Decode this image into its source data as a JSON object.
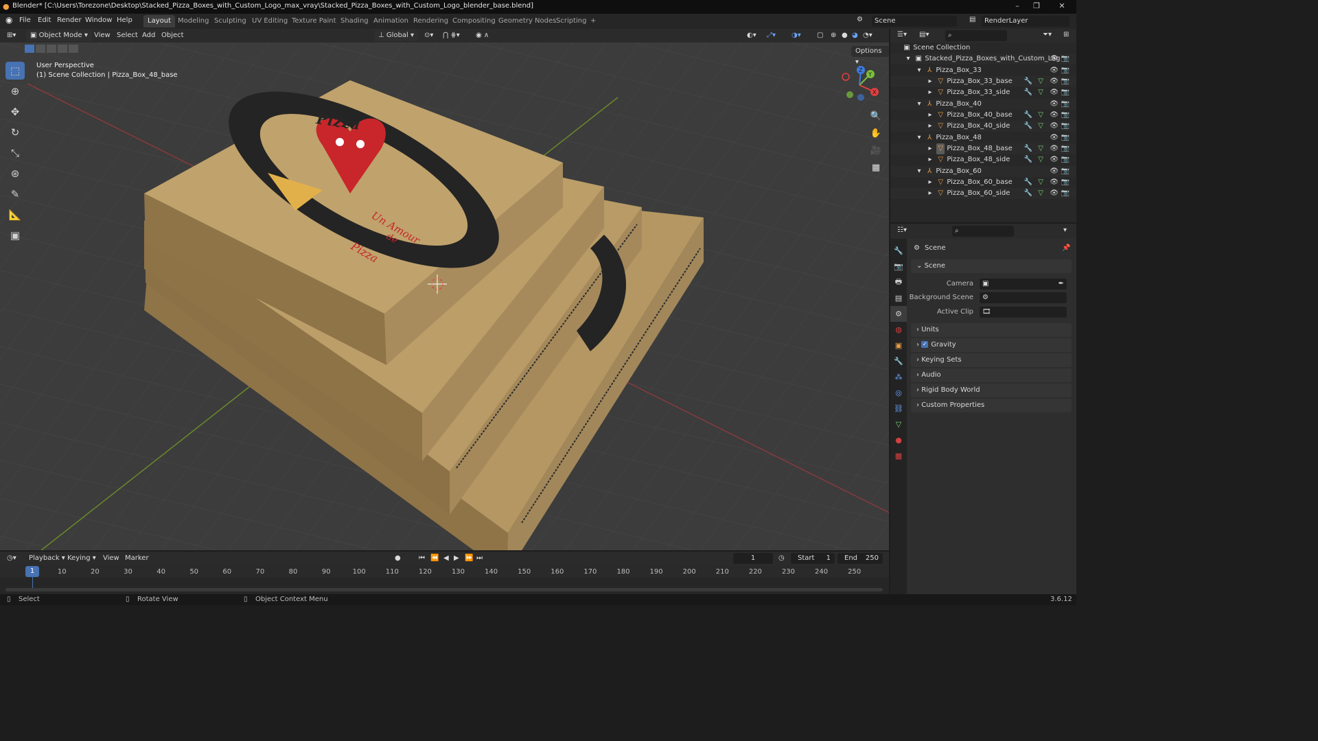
{
  "window": {
    "title": "Blender* [C:\\Users\\Torezone\\Desktop\\Stacked_Pizza_Boxes_with_Custom_Logo_max_vray\\Stacked_Pizza_Boxes_with_Custom_Logo_blender_base.blend]",
    "minimize": "–",
    "restore": "❐",
    "close": "✕"
  },
  "menu": {
    "file": "File",
    "edit": "Edit",
    "render": "Render",
    "window": "Window",
    "help": "Help"
  },
  "workspaces": [
    "Layout",
    "Modeling",
    "Sculpting",
    "UV Editing",
    "Texture Paint",
    "Shading",
    "Animation",
    "Rendering",
    "Compositing",
    "Geometry Nodes",
    "Scripting"
  ],
  "workspace_add": "+",
  "scene_selector": {
    "scene": "Scene",
    "view_layer": "RenderLayer"
  },
  "viewport_header": {
    "mode": "Object Mode",
    "view": "View",
    "select": "Select",
    "add": "Add",
    "object": "Object",
    "transform_orientation": "Global",
    "options": "Options"
  },
  "viewport": {
    "perspective": "User Perspective",
    "context": "(1) Scene Collection | Pizza_Box_48_base",
    "gizmo_axes": {
      "x": "X",
      "y": "Y",
      "z": "Z"
    },
    "logo_text": {
      "title": "Pizza",
      "line1": "Un Amour",
      "line2": "de",
      "line3": "Pizza"
    }
  },
  "outliner": {
    "root": "Scene Collection",
    "collection": "Stacked_Pizza_Boxes_with_Custom_Log",
    "groups": [
      {
        "name": "Pizza_Box_33",
        "children": [
          "Pizza_Box_33_base",
          "Pizza_Box_33_side"
        ]
      },
      {
        "name": "Pizza_Box_40",
        "children": [
          "Pizza_Box_40_base",
          "Pizza_Box_40_side"
        ]
      },
      {
        "name": "Pizza_Box_48",
        "children": [
          "Pizza_Box_48_base",
          "Pizza_Box_48_side"
        ]
      },
      {
        "name": "Pizza_Box_60",
        "children": [
          "Pizza_Box_60_base",
          "Pizza_Box_60_side"
        ]
      }
    ]
  },
  "properties": {
    "breadcrumb": "Scene",
    "section": "Scene",
    "fields": {
      "camera": "Camera",
      "background_scene": "Background Scene",
      "active_clip": "Active Clip"
    },
    "panels": [
      "Units",
      "Gravity",
      "Keying Sets",
      "Audio",
      "Rigid Body World",
      "Custom Properties"
    ],
    "gravity_checked": true
  },
  "timeline": {
    "playback": "Playback",
    "keying": "Keying",
    "view": "View",
    "marker": "Marker",
    "current_frame": "1",
    "start_label": "Start",
    "start": "1",
    "end_label": "End",
    "end": "250",
    "ticks": [
      "10",
      "20",
      "30",
      "40",
      "50",
      "60",
      "70",
      "80",
      "90",
      "100",
      "110",
      "120",
      "130",
      "140",
      "150",
      "160",
      "170",
      "180",
      "190",
      "200",
      "210",
      "220",
      "230",
      "240",
      "250"
    ],
    "playhead": "1"
  },
  "status": {
    "select": "Select",
    "rotate": "Rotate View",
    "context_menu": "Object Context Menu",
    "version": "3.6.12"
  },
  "colors": {
    "accent": "#4772b3",
    "selection": "#334d80",
    "cardboard": "#b69a6a",
    "logo_red": "#c8262b"
  }
}
